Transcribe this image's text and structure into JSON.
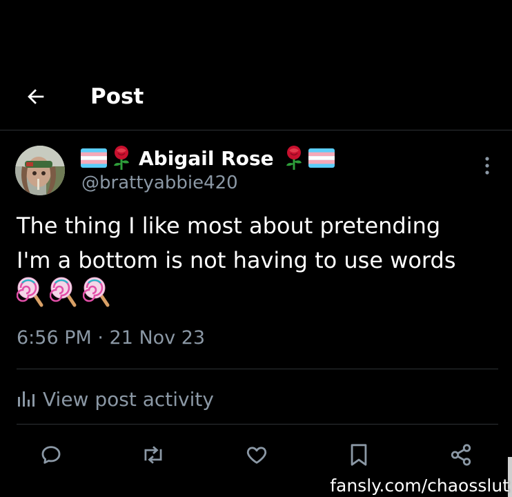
{
  "header": {
    "title": "Post",
    "back_icon": "arrow-left-icon"
  },
  "author": {
    "display_name": "Abigail Rose",
    "handle": "@brattyabbie420",
    "name_prefix_emoji": [
      "transgender-flag",
      "rose"
    ],
    "name_suffix_emoji": [
      "rose",
      "transgender-flag"
    ]
  },
  "tweet": {
    "lines": [
      "The thing I like most about pretending",
      "I'm a bottom is not having to use words"
    ],
    "emoji": [
      "lollipop",
      "lollipop",
      "lollipop"
    ],
    "timestamp": "6:56 PM · 21 Nov 23"
  },
  "activity": {
    "label": "View post activity",
    "icon": "bar-chart-icon"
  },
  "actions": [
    {
      "name": "reply",
      "icon": "speech-bubble-icon"
    },
    {
      "name": "repost",
      "icon": "repost-icon"
    },
    {
      "name": "like",
      "icon": "heart-icon"
    },
    {
      "name": "bookmark",
      "icon": "bookmark-icon"
    },
    {
      "name": "share",
      "icon": "share-icon"
    }
  ],
  "watermark": "fansly.com/chaosslut",
  "colors": {
    "background": "#000000",
    "text": "#e7e9ea",
    "secondary": "#8b98a5",
    "divider": "#2f3336"
  }
}
